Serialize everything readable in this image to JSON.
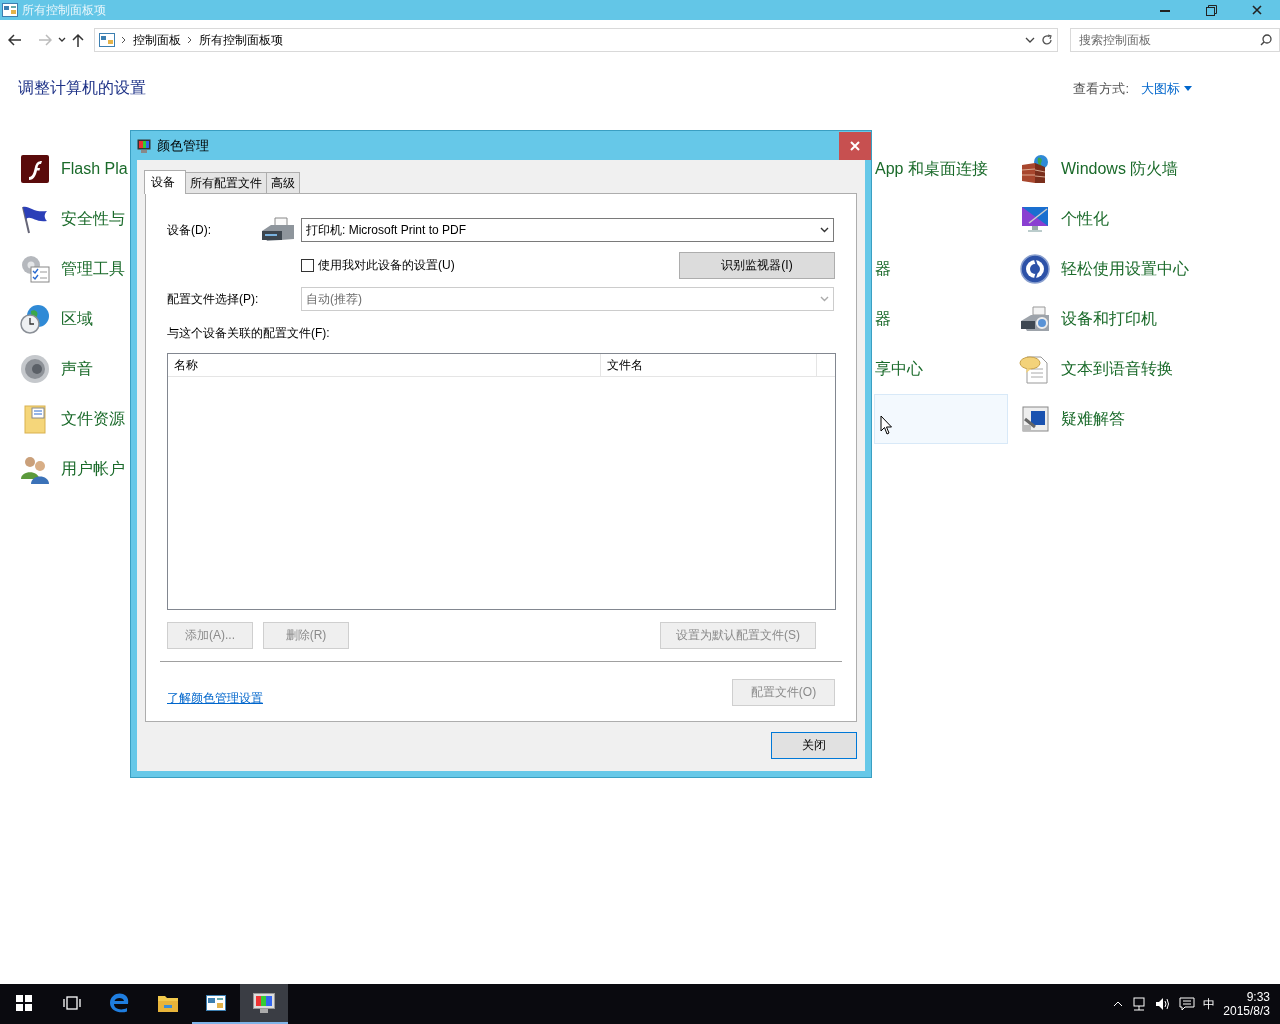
{
  "window": {
    "title": "所有控制面板项"
  },
  "address": {
    "path": [
      "控制面板",
      "所有控制面板项"
    ]
  },
  "search": {
    "placeholder": "搜索控制面板"
  },
  "heading": "调整计算机的设置",
  "view_by": {
    "label": "查看方式:",
    "value": "大图标"
  },
  "columns": [
    {
      "items": [
        {
          "label": "Flash Pla",
          "highlighted": false
        },
        {
          "label": "安全性与",
          "highlighted": false
        },
        {
          "label": "管理工具",
          "highlighted": false
        },
        {
          "label": "区域",
          "highlighted": false
        },
        {
          "label": "声音",
          "highlighted": false
        },
        {
          "label": "文件资源",
          "highlighted": false
        },
        {
          "label": "用户帐户",
          "highlighted": false
        }
      ]
    },
    {
      "items": [
        {
          "label": "App 和桌面连接",
          "highlighted": false
        },
        {
          "highlighted": false
        },
        {
          "label": "器",
          "highlighted": false
        },
        {
          "label": "器",
          "highlighted": false
        },
        {
          "label": "享中心",
          "highlighted": false
        },
        {
          "highlighted": true
        }
      ]
    },
    {
      "items": [
        {
          "label": "Windows 防火墙",
          "highlighted": false
        },
        {
          "label": "个性化",
          "highlighted": false
        },
        {
          "label": "轻松使用设置中心",
          "highlighted": false
        },
        {
          "label": "设备和打印机",
          "highlighted": false
        },
        {
          "label": "文本到语音转换",
          "highlighted": false
        },
        {
          "label": "疑难解答",
          "highlighted": false
        }
      ]
    }
  ],
  "dialog": {
    "title": "颜色管理",
    "tabs": [
      {
        "label": "设备",
        "selected": true
      },
      {
        "label": "所有配置文件",
        "selected": false
      },
      {
        "label": "高级",
        "selected": false
      }
    ],
    "device": {
      "label": "设备(D):",
      "value": "打印机: Microsoft Print to PDF"
    },
    "use_my_settings": {
      "label": "使用我对此设备的设置(U)",
      "checked": false
    },
    "identify_button": {
      "label": "识别监视器(I)",
      "disabled": false
    },
    "profile_selection": {
      "label": "配置文件选择(P):",
      "value": "自动(推荐)",
      "disabled": true
    },
    "associated_label": "与这个设备关联的配置文件(F):",
    "table": {
      "columns": [
        "名称",
        "文件名"
      ]
    },
    "buttons": [
      {
        "label": "添加(A)...",
        "disabled": true
      },
      {
        "label": "删除(R)",
        "disabled": true
      },
      {
        "label": "设置为默认配置文件(S)",
        "disabled": true
      }
    ],
    "link": "了解颜色管理设置",
    "profiles_button": {
      "label": "配置文件(O)",
      "disabled": true
    },
    "close_button": "关闭"
  },
  "taskbar": {
    "apps": [
      {
        "running": false,
        "selected": false
      },
      {
        "running": false,
        "selected": false
      },
      {
        "running": true,
        "selected": false
      },
      {
        "running": true,
        "selected": true
      }
    ],
    "ime": "中",
    "time": "9:33",
    "date": "2015/8/3"
  }
}
